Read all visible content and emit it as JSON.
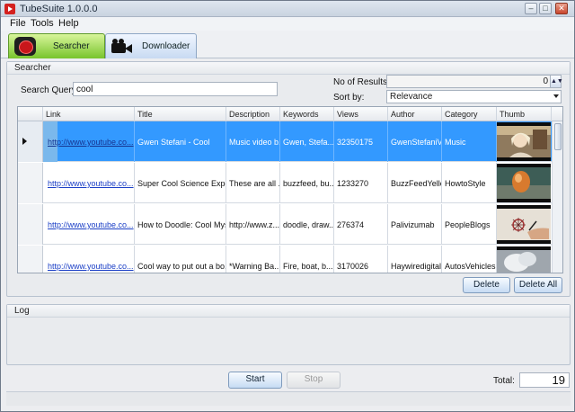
{
  "window": {
    "title": "TubeSuite 1.0.0.0"
  },
  "menu": [
    "File",
    "Tools",
    "Help"
  ],
  "tabs": [
    {
      "label": "Searcher",
      "active": true
    },
    {
      "label": "Downloader",
      "active": false
    }
  ],
  "searcher": {
    "panel_title": "Searcher",
    "query_label": "Search Query:",
    "query_value": "cool",
    "results_label": "No of Results:",
    "results_value": "0",
    "sort_label": "Sort by:",
    "sort_value": "Relevance"
  },
  "grid": {
    "columns": [
      "Link",
      "Title",
      "Description",
      "Keywords",
      "Views",
      "Author",
      "Category",
      "Thumb"
    ],
    "rows": [
      {
        "link": "http://www.youtube.co...",
        "title": "Gwen Stefani - Cool",
        "description": "Music video b...",
        "keywords": "Gwen, Stefa...",
        "views": "32350175",
        "author": "GwenStefaniV...",
        "category": "Music",
        "selected": true,
        "thumb": "thumb-woman"
      },
      {
        "link": "http://www.youtube.co...",
        "title": "Super Cool Science Exper...",
        "description": "These are all ...",
        "keywords": "buzzfeed, bu...",
        "views": "1233270",
        "author": "BuzzFeedYellow",
        "category": "HowtoStyle",
        "selected": false,
        "thumb": "thumb-egg"
      },
      {
        "link": "http://www.youtube.co...",
        "title": "How to Doodle: Cool Mys...",
        "description": "http://www.z...",
        "keywords": "doodle, draw...",
        "views": "276374",
        "author": "Palivizumab",
        "category": "PeopleBlogs",
        "selected": false,
        "thumb": "thumb-drawing"
      },
      {
        "link": "http://www.youtube.co...",
        "title": "Cool way to put out a bo...",
        "description": "*Warning Ba...",
        "keywords": "Fire, boat, b...",
        "views": "3170026",
        "author": "Haywiredigital",
        "category": "AutosVehicles",
        "selected": false,
        "thumb": "thumb-smoke"
      }
    ]
  },
  "buttons": {
    "delete": "Delete",
    "delete_all": "Delete All",
    "start": "Start",
    "stop": "Stop"
  },
  "log": {
    "title": "Log"
  },
  "footer": {
    "total_label": "Total:",
    "total_value": "19"
  },
  "colors": {
    "selection": "#3399ff",
    "active_tab": "#78c42d",
    "link": "#1b3fc6"
  }
}
